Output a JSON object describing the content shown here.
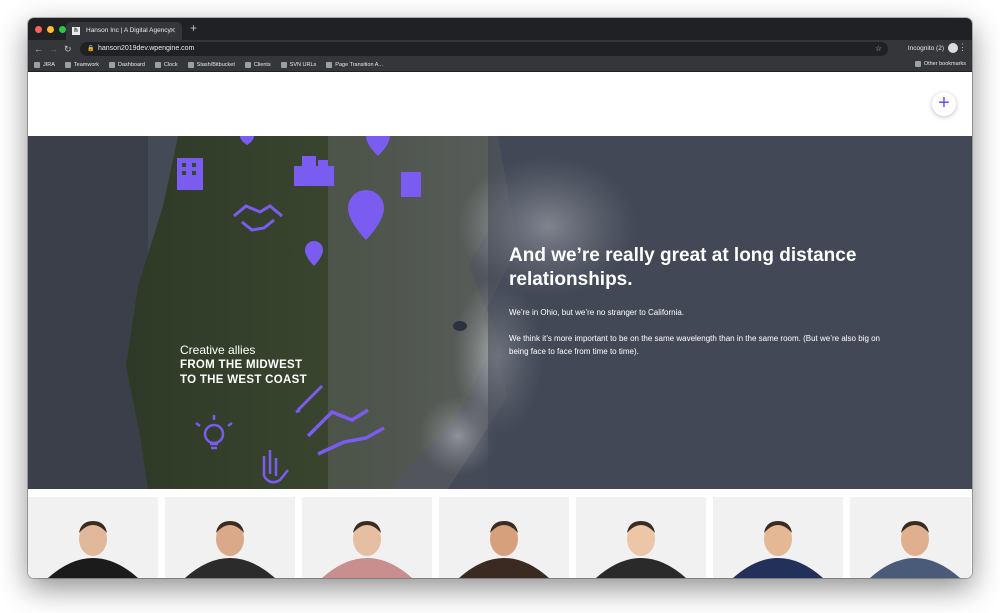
{
  "browser": {
    "tab_title": "Hanson Inc | A Digital Agency",
    "favicon_letter": "h",
    "url": "hanson2019dev.wpengine.com",
    "profile_label": "Incognito (2)",
    "bookmarks": [
      {
        "label": "JIRA",
        "icon": "jira-icon"
      },
      {
        "label": "Teamwork",
        "icon": "hanson-icon"
      },
      {
        "label": "Dashboard",
        "icon": "hanson-icon"
      },
      {
        "label": "Clock",
        "icon": "clock-icon"
      },
      {
        "label": "Stash/Bitbucket",
        "icon": "bitbucket-icon"
      },
      {
        "label": "Clients",
        "icon": "folder-icon"
      },
      {
        "label": "SVN URLs",
        "icon": "hanson-icon"
      },
      {
        "label": "Page Transition A...",
        "icon": "bookmark-icon"
      }
    ],
    "other_bookmarks": "Other bookmarks"
  },
  "site": {
    "plus_label": "+"
  },
  "hero": {
    "title": "And we’re really great at long distance relationships.",
    "para1": "We’re in Ohio, but we’re no stranger to California.",
    "para2": "We think it’s more important to be on the same wavelength than in the same room. (But we’re also big on being face to face from time to time).",
    "allies_line1": "Creative allies",
    "allies_line2": "FROM THE MIDWEST",
    "allies_line3": "TO THE WEST COAST"
  },
  "team_cards": [
    {
      "name": "team-member-1"
    },
    {
      "name": "team-member-2"
    },
    {
      "name": "team-member-3"
    },
    {
      "name": "team-member-4"
    },
    {
      "name": "team-member-5"
    },
    {
      "name": "team-member-6"
    },
    {
      "name": "team-member-7"
    }
  ],
  "colors": {
    "accent": "#6a4bff",
    "icon_purple": "#7b5cf0",
    "hero_bg": "#454a57",
    "chrome_dark": "#202124",
    "chrome_mid": "#35363a"
  }
}
